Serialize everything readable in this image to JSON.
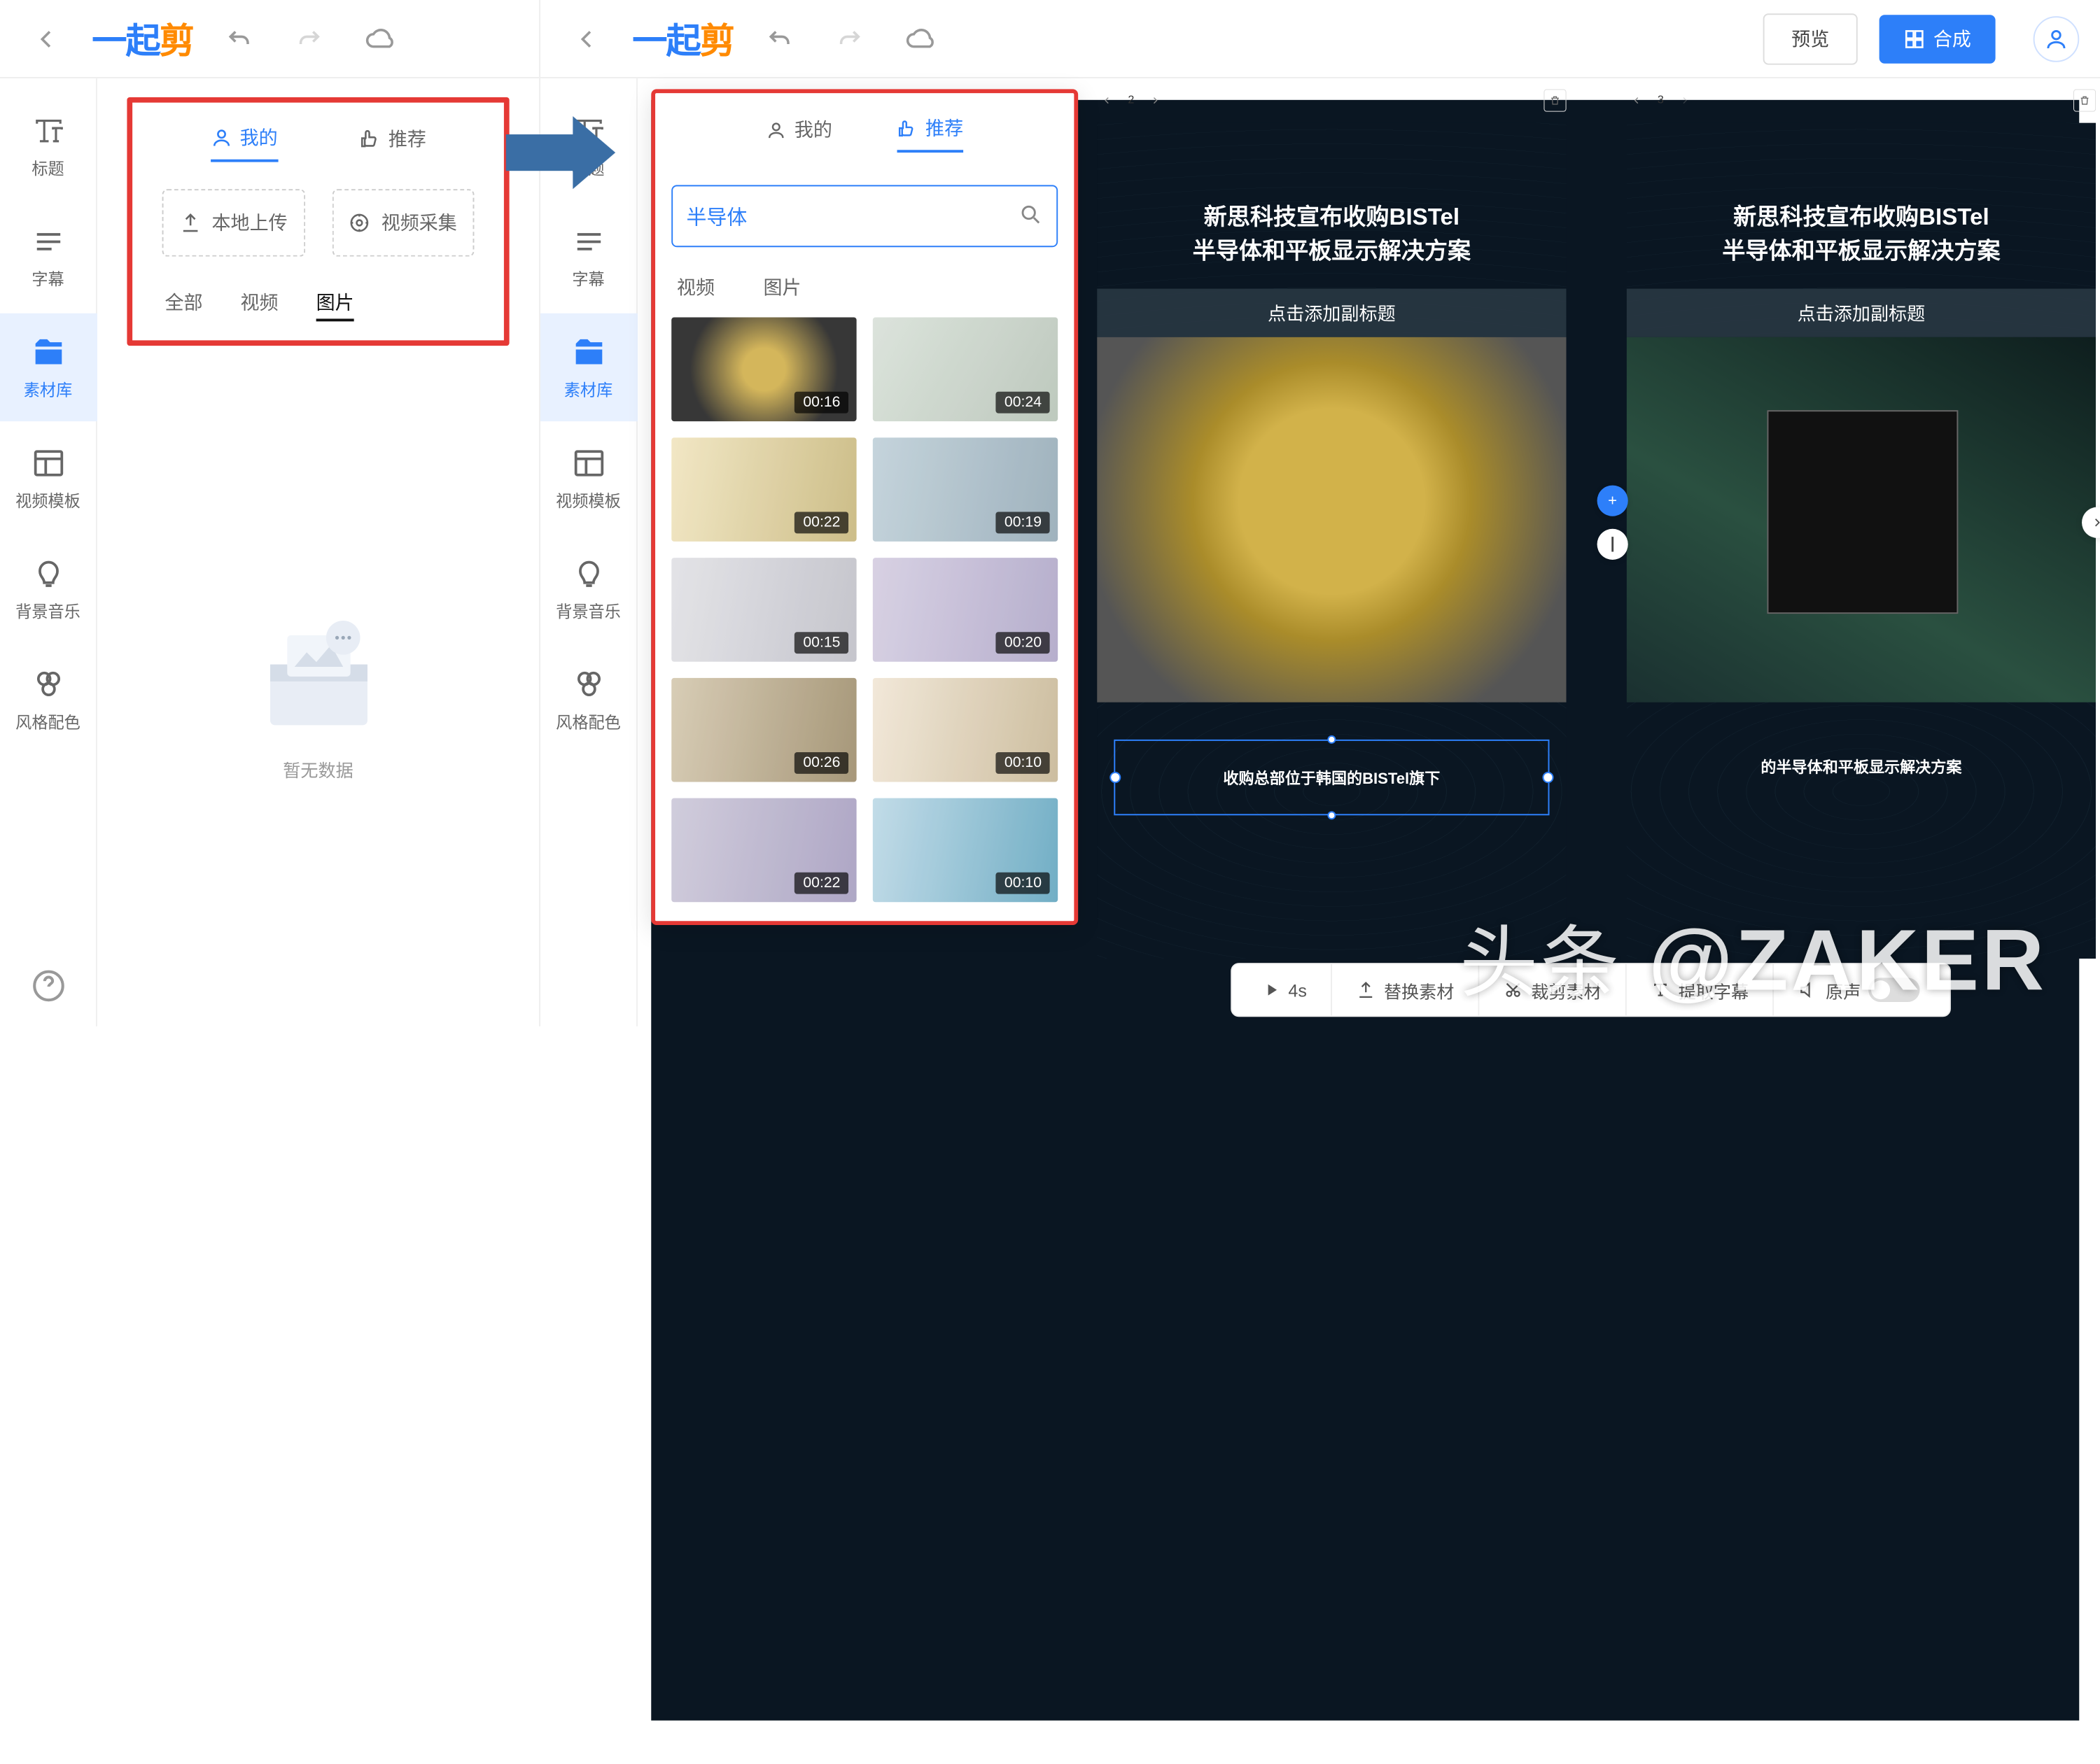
{
  "logo_parts": [
    "一",
    "起",
    "剪"
  ],
  "topbar": {
    "preview": "预览",
    "compose": "合成"
  },
  "vnav": {
    "title": "标题",
    "subtitle": "字幕",
    "library": "素材库",
    "templates": "视频模板",
    "music": "背景音乐",
    "styles": "风格配色"
  },
  "left_panel": {
    "tab_mine": "我的",
    "tab_recommend": "推荐",
    "upload_local": "本地上传",
    "video_capture": "视频采集",
    "filter_all": "全部",
    "filter_video": "视频",
    "filter_image": "图片",
    "empty_text": "暂无数据"
  },
  "right_panel": {
    "tab_mine": "我的",
    "tab_recommend": "推荐",
    "search_value": "半导体",
    "filter_video": "视频",
    "filter_image": "图片",
    "results": [
      {
        "duration": "00:16"
      },
      {
        "duration": "00:24"
      },
      {
        "duration": "00:22"
      },
      {
        "duration": "00:19"
      },
      {
        "duration": "00:15"
      },
      {
        "duration": "00:20"
      },
      {
        "duration": "00:26"
      },
      {
        "duration": "00:10"
      },
      {
        "duration": "00:22"
      },
      {
        "duration": "00:10"
      }
    ]
  },
  "slides": {
    "page2_num": "2",
    "page3_num": "3",
    "headline_l1": "新思科技宣布收购BISTel",
    "headline_l2": "半导体和平板显示解决方案",
    "subheading": "点击添加副标题",
    "caption2": "收购总部位于韩国的BISTel旗下",
    "caption3": "的半导体和平板显示解决方案"
  },
  "bottombar": {
    "duration": "4s",
    "replace": "替换素材",
    "crop": "裁剪素材",
    "extract": "提取字幕",
    "audio": "原声"
  },
  "watermark": "头条 @ZAKER"
}
